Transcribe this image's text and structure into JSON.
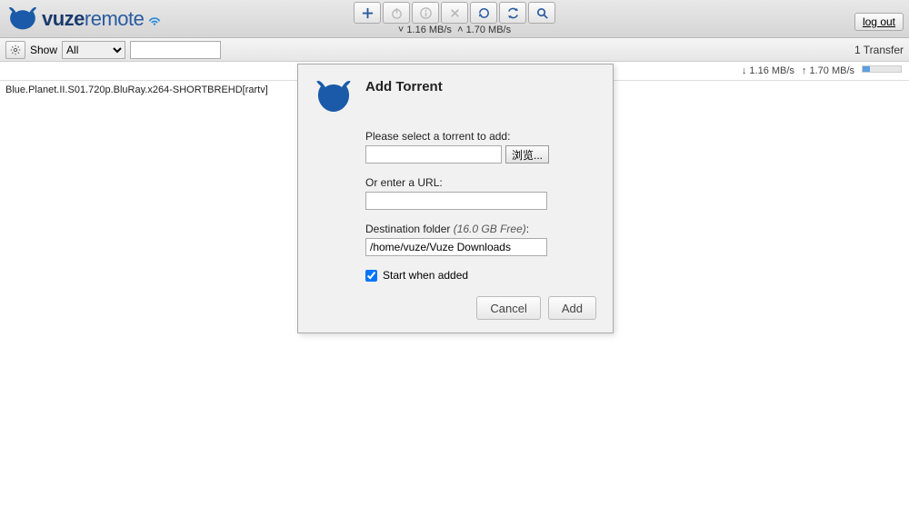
{
  "header": {
    "brand_main": "vuze",
    "brand_sub": "remote",
    "speed_down": "1.16 MB/s",
    "speed_up": "1.70 MB/s",
    "logout_label": "log out"
  },
  "toolbar": {
    "icons": [
      "plus",
      "power",
      "info",
      "close",
      "refresh-one",
      "refresh-all",
      "search"
    ]
  },
  "filter": {
    "show_label": "Show",
    "show_value": "All",
    "search_value": "",
    "count_label": "1 Transfer"
  },
  "list": {
    "speed_down": "↓ 1.16 MB/s",
    "speed_up": "↑ 1.70 MB/s",
    "rows": [
      {
        "name": "Blue.Planet.II.S01.720p.BluRay.x264-SHORTBREHD[rartv]"
      }
    ]
  },
  "dialog": {
    "title": "Add Torrent",
    "select_label": "Please select a torrent to add:",
    "browse_label": "浏览...",
    "url_label": "Or enter a URL:",
    "url_value": "",
    "dest_label_prefix": "Destination folder ",
    "dest_free": "(16.0 GB Free)",
    "dest_label_suffix": ":",
    "dest_value": "/home/vuze/Vuze Downloads",
    "start_label": "Start when added",
    "start_checked": true,
    "cancel_label": "Cancel",
    "add_label": "Add"
  }
}
